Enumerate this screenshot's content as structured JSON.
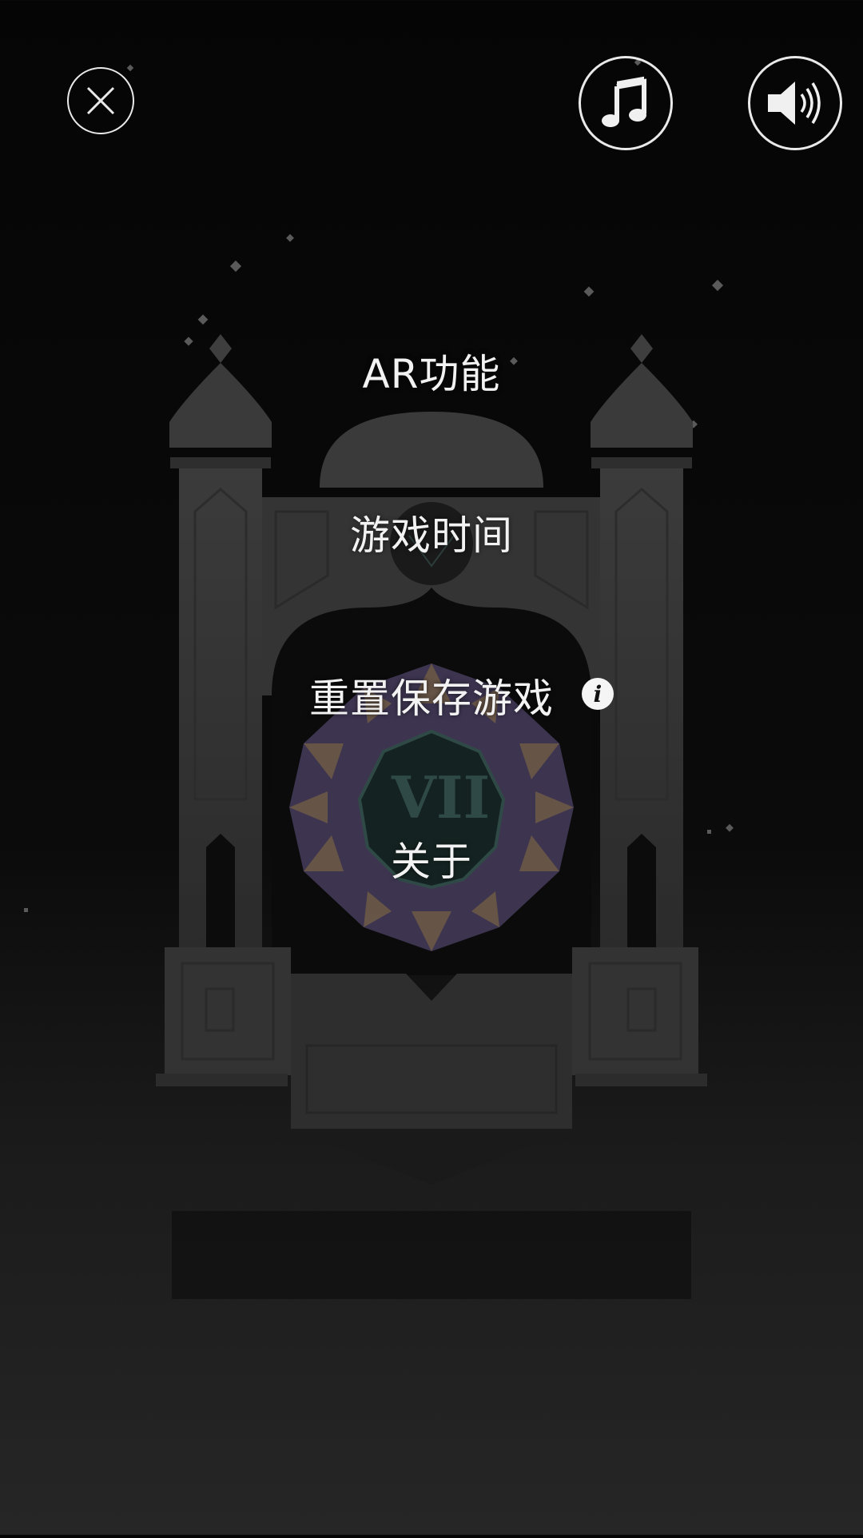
{
  "top_bar": {
    "close_icon": "close-icon",
    "music_icon": "music-note-icon",
    "sound_icon": "speaker-volume-icon"
  },
  "menu": {
    "ar": "AR功能",
    "playtime": "游戏时间",
    "reset_save": "重置保存游戏",
    "about": "关于"
  },
  "emblem": {
    "numeral": "VII"
  },
  "colors": {
    "text": "#f2f2f2",
    "tower": "#3a3a3a",
    "tower_dark": "#2e2e2e"
  }
}
